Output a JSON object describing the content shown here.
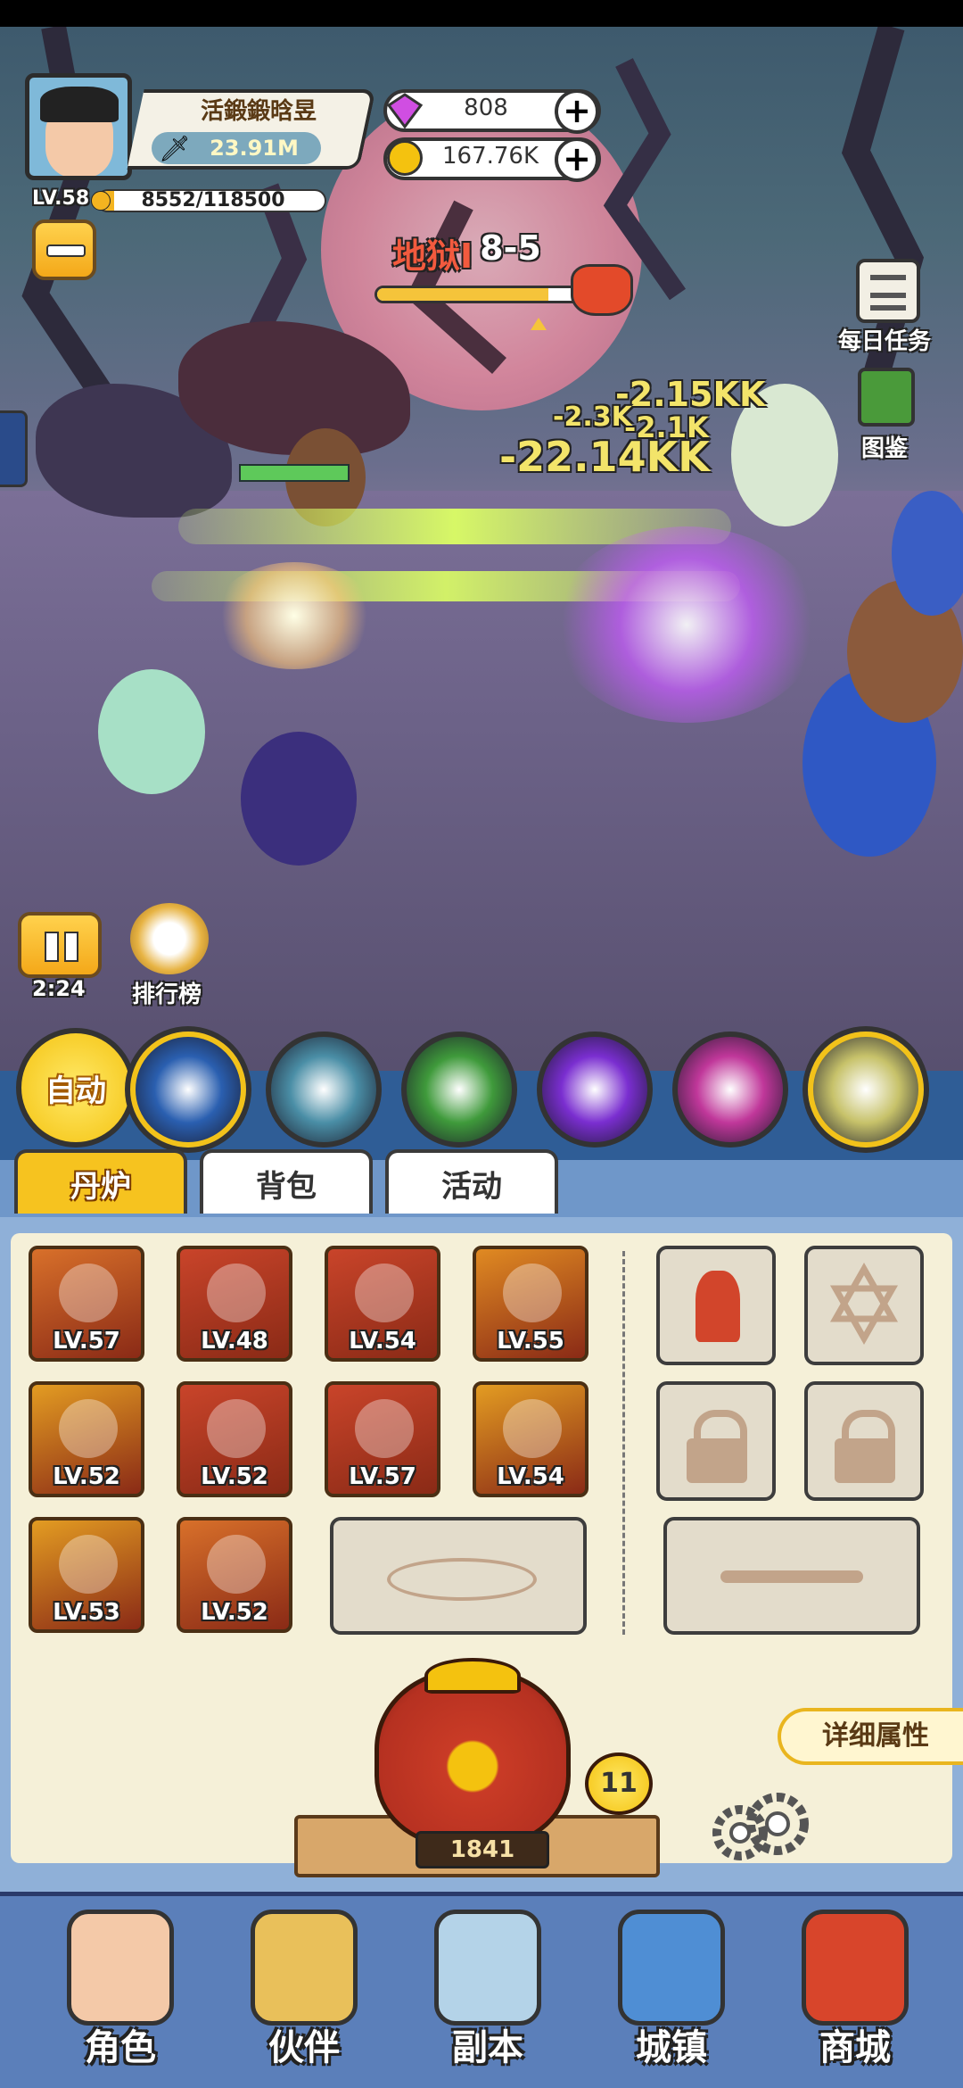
{
  "player": {
    "name": "活鍛鍛晗昱",
    "power": "23.91M",
    "level": "LV.58",
    "exp": "8552/118500",
    "exp_fraction": 0.072
  },
  "currency": {
    "gems": "808",
    "gold": "167.76K"
  },
  "stage": {
    "name": "地狱I",
    "number": "8-5",
    "progress_fraction": 0.85
  },
  "damage_texts": [
    "-22.14KK",
    "-2.15KK",
    "-2.1K",
    "-2.3K"
  ],
  "right_menu": {
    "daily_tasks": "每日任务",
    "codex": "图鉴"
  },
  "battle_controls": {
    "timer": "2:24",
    "ranking": "排行榜"
  },
  "skills": {
    "auto_label": "自动",
    "items": [
      {
        "icon": "blue-comet-icon",
        "color": "#2a5fb0"
      },
      {
        "icon": "ice-dragon-icon",
        "color": "#4a8ea6"
      },
      {
        "icon": "green-orb-icon",
        "color": "#3f9a3b"
      },
      {
        "icon": "purple-vortex-icon",
        "color": "#7a2ed0"
      },
      {
        "icon": "pink-spiral-icon",
        "color": "#c0379a"
      },
      {
        "icon": "lightning-rune-icon",
        "color": "#c7c26a"
      }
    ]
  },
  "tabs": [
    "丹炉",
    "背包",
    "活动"
  ],
  "equipment": [
    {
      "icon": "sword-icon",
      "level": "LV.57",
      "bg": "#d8702a"
    },
    {
      "icon": "horned-helmet-icon",
      "level": "LV.48",
      "bg": "#c9442a"
    },
    {
      "icon": "robe-icon",
      "level": "LV.54",
      "bg": "#c9442a"
    },
    {
      "icon": "phoenix-orb-icon",
      "level": "LV.55",
      "bg": "#e08a22"
    },
    {
      "icon": "golden-wing-icon",
      "level": "LV.52",
      "bg": "#e39c22"
    },
    {
      "icon": "bagua-icon",
      "level": "LV.52",
      "bg": "#c9442a"
    },
    {
      "icon": "dragon-whip-icon",
      "level": "LV.57",
      "bg": "#c9442a"
    },
    {
      "icon": "golden-dragon-orb-icon",
      "level": "LV.54",
      "bg": "#e39c22"
    },
    {
      "icon": "belt-icon",
      "level": "LV.53",
      "bg": "#e39c22"
    },
    {
      "icon": "boots-icon",
      "level": "LV.52",
      "bg": "#d8702a"
    }
  ],
  "furnace": {
    "count": "1841",
    "level": "11",
    "details_label": "详细属性"
  },
  "bottom_nav": [
    "角色",
    "伙伴",
    "副本",
    "城镇",
    "商城"
  ]
}
